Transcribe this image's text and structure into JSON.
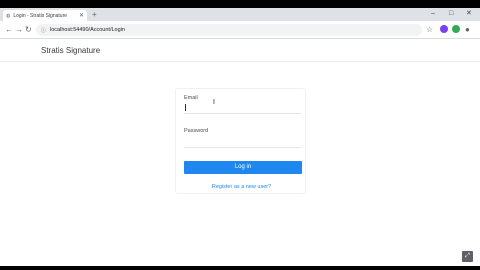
{
  "browser": {
    "tab_title": "Login - Stratis Signature",
    "tab_favicon": "globe-icon",
    "new_tab_symbol": "+",
    "url": "localhost:54490/Account/Login",
    "window_controls": {
      "minimize": "–",
      "maximize": "□",
      "close": "✕"
    },
    "nav": {
      "back": "←",
      "forward": "→",
      "reload": "↻"
    },
    "toolbar_icons": {
      "star": "☆",
      "extensions": "◆",
      "profile": "●",
      "menu": "⋮"
    }
  },
  "app": {
    "brand": "Stratis Signature",
    "form": {
      "email_label": "Email",
      "email_value": "",
      "password_label": "Password",
      "password_value": "",
      "login_button": "Log in",
      "register_link": "Register as a new user?"
    },
    "footer": "",
    "corner_icon": "fullscreen-icon"
  },
  "colors": {
    "accent": "#1e87f0",
    "extension_green": "#34a853",
    "extension_purple": "#7b3ff2"
  }
}
